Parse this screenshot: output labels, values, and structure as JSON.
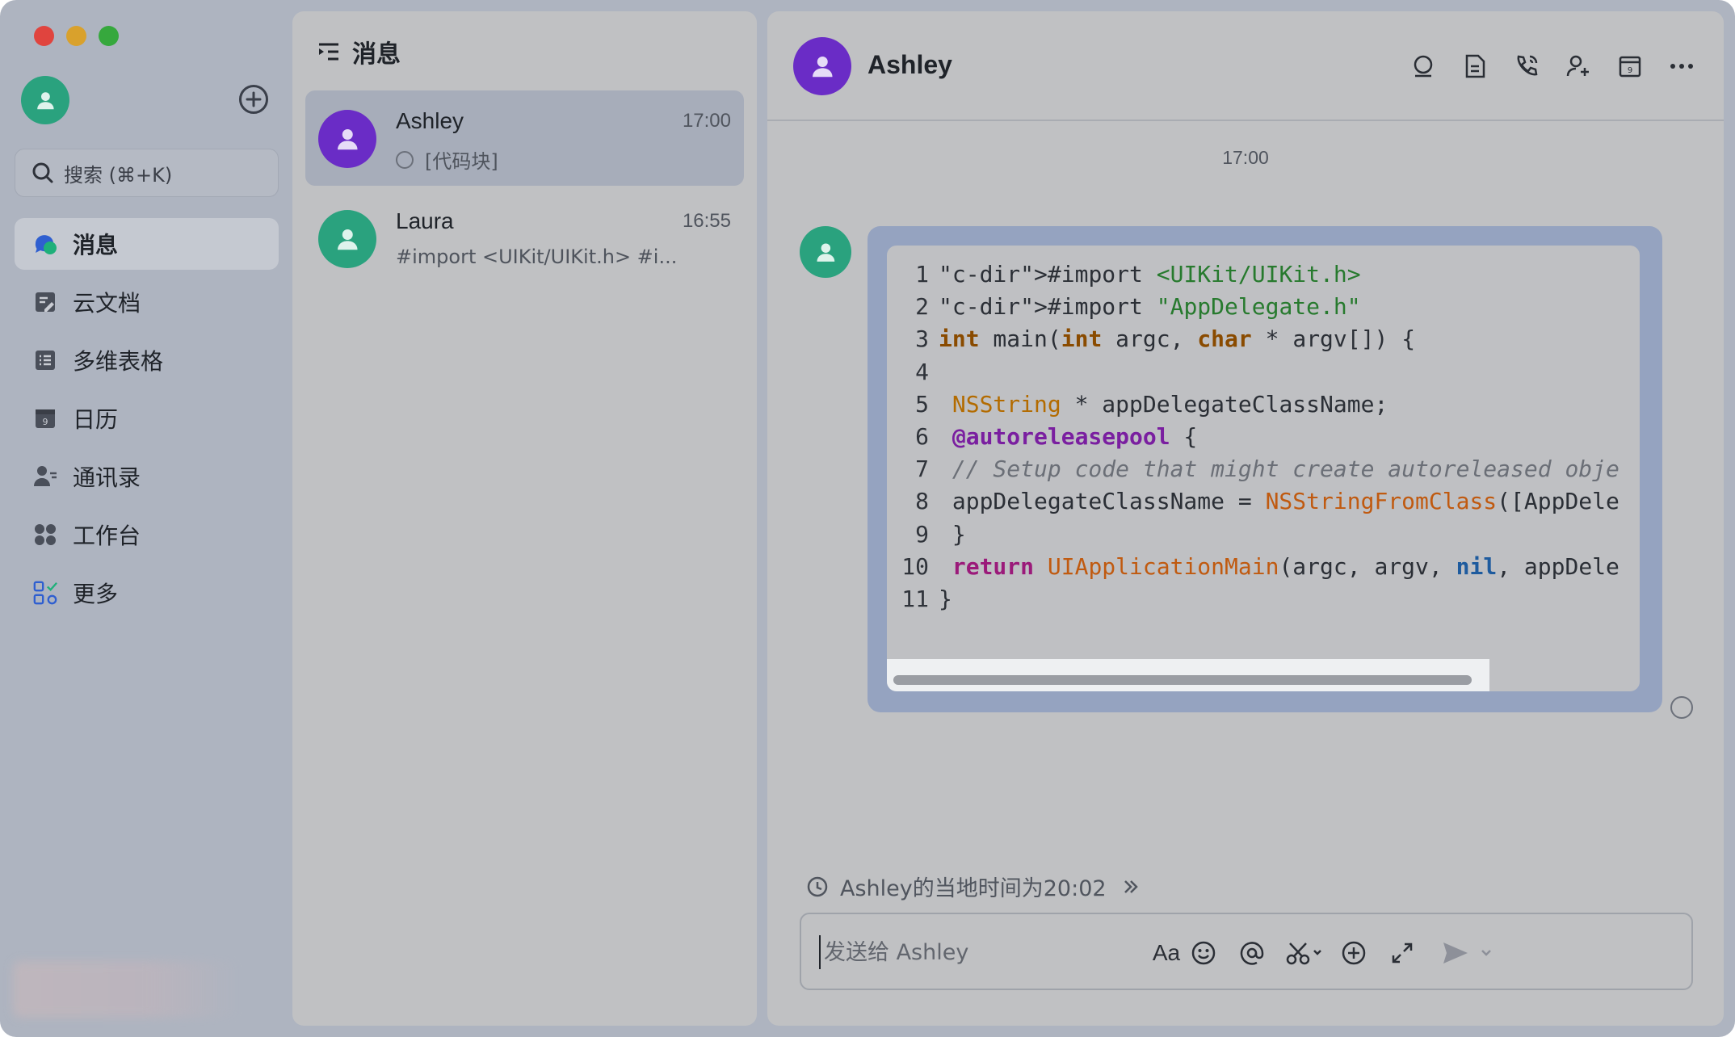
{
  "window": {
    "traffic_lights": [
      {
        "name": "close",
        "color": "#e0443e"
      },
      {
        "name": "minimize",
        "color": "#d9a12c"
      },
      {
        "name": "zoom",
        "color": "#36a83d"
      }
    ]
  },
  "colors": {
    "accent_green": "#2aa27e",
    "accent_purple": "#6a2cc6",
    "active_bg": "#a7adba",
    "bubble_bg": "#95a3c0"
  },
  "nav": {
    "search_placeholder": "搜索 (⌘+K)",
    "items": [
      {
        "label": "消息",
        "icon": "messages-icon",
        "active": true
      },
      {
        "label": "云文档",
        "icon": "cloud-docs-icon"
      },
      {
        "label": "多维表格",
        "icon": "base-table-icon"
      },
      {
        "label": "日历",
        "icon": "calendar-icon"
      },
      {
        "label": "通讯录",
        "icon": "contacts-icon"
      },
      {
        "label": "工作台",
        "icon": "workplace-icon"
      },
      {
        "label": "更多",
        "icon": "more-apps-icon"
      }
    ]
  },
  "list": {
    "title": "消息",
    "conversations": [
      {
        "name": "Ashley",
        "time": "17:00",
        "preview": "[代码块]",
        "avatar_color": "#6a2cc6",
        "active": true
      },
      {
        "name": "Laura",
        "time": "16:55",
        "preview": "#import <UIKit/UIKit.h> #i...",
        "avatar_color": "#2aa27e",
        "active": false
      }
    ]
  },
  "chat": {
    "title": "Ashley",
    "header_icons": [
      "search-icon",
      "document-icon",
      "phone-call-icon",
      "add-member-icon",
      "calendar-icon",
      "more-icon"
    ],
    "message_time": "17:00",
    "code_lines": [
      "#import <UIKit/UIKit.h>",
      "#import \"AppDelegate.h\"",
      "int main(int argc, char * argv[]) {",
      "",
      " NSString * appDelegateClassName;",
      " @autoreleasepool {",
      " // Setup code that might create autoreleased obje",
      " appDelegateClassName = NSStringFromClass([AppDele",
      " }",
      " return UIApplicationMain(argc, argv, nil, appDele",
      "}"
    ],
    "line_numbers": [
      "1",
      "2",
      "3",
      "4",
      "5",
      "6",
      "7",
      "8",
      "9",
      "10",
      "11"
    ],
    "local_time_text": "Ashley的当地时间为20:02",
    "composer": {
      "placeholder": "发送给 Ashley",
      "value": "",
      "tools": [
        "text-format-icon",
        "emoji-icon",
        "mention-icon",
        "screenshot-icon",
        "add-icon",
        "expand-icon"
      ],
      "font_button_label": "Aa"
    }
  }
}
